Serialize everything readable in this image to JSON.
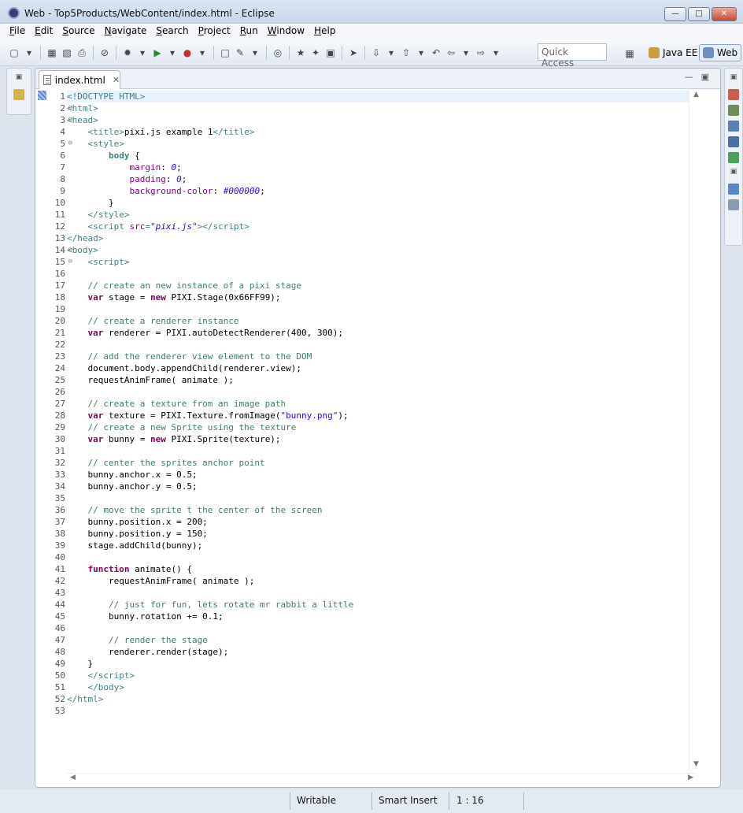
{
  "window": {
    "title": "Web - Top5Products/WebContent/index.html - Eclipse"
  },
  "menu": [
    "File",
    "Edit",
    "Source",
    "Navigate",
    "Search",
    "Project",
    "Run",
    "Window",
    "Help"
  ],
  "toolbar": {
    "quick_access_placeholder": "Quick Access"
  },
  "perspectives": {
    "java_ee": "Java EE",
    "web": "Web"
  },
  "editor": {
    "tab_label": "index.html",
    "line_count": 53,
    "fold_lines": [
      2,
      3,
      5,
      14,
      15
    ],
    "cursor_line": 1
  },
  "code": [
    "&lt;!DOCTYPE HTML&gt;",
    "&lt;html&gt;",
    "&lt;head&gt;",
    "    &lt;title&gt;pixi.js example 1&lt;/title&gt;",
    "    &lt;style&gt;",
    "        body {",
    "            margin: 0;",
    "            padding: 0;",
    "            background-color: #000000;",
    "        }",
    "    &lt;/style&gt;",
    "    &lt;script src=\"pixi.js\"&gt;&lt;/script&gt;",
    "&lt;/head&gt;",
    "&lt;body&gt;",
    "    &lt;script&gt;",
    "",
    "    // create an new instance of a pixi stage",
    "    var stage = new PIXI.Stage(0x66FF99);",
    "",
    "    // create a renderer instance",
    "    var renderer = PIXI.autoDetectRenderer(400, 300);",
    "",
    "    // add the renderer view element to the DOM",
    "    document.body.appendChild(renderer.view);",
    "    requestAnimFrame( animate );",
    "",
    "    // create a texture from an image path",
    "    var texture = PIXI.Texture.fromImage(\"bunny.png\");",
    "    // create a new Sprite using the texture",
    "    var bunny = new PIXI.Sprite(texture);",
    "",
    "    // center the sprites anchor point",
    "    bunny.anchor.x = 0.5;",
    "    bunny.anchor.y = 0.5;",
    "",
    "    // move the sprite t the center of the screen",
    "    bunny.position.x = 200;",
    "    bunny.position.y = 150;",
    "    stage.addChild(bunny);",
    "",
    "    function animate() {",
    "        requestAnimFrame( animate );",
    "",
    "        // just for fun, lets rotate mr rabbit a little",
    "        bunny.rotation += 0.1;",
    "",
    "        // render the stage",
    "        renderer.render(stage);",
    "    }",
    "    &lt;/script&gt;",
    "    &lt;/body&gt;",
    "&lt;/html&gt;",
    ""
  ],
  "status": {
    "mode": "Writable",
    "insert": "Smart Insert",
    "position": "1 : 16"
  }
}
